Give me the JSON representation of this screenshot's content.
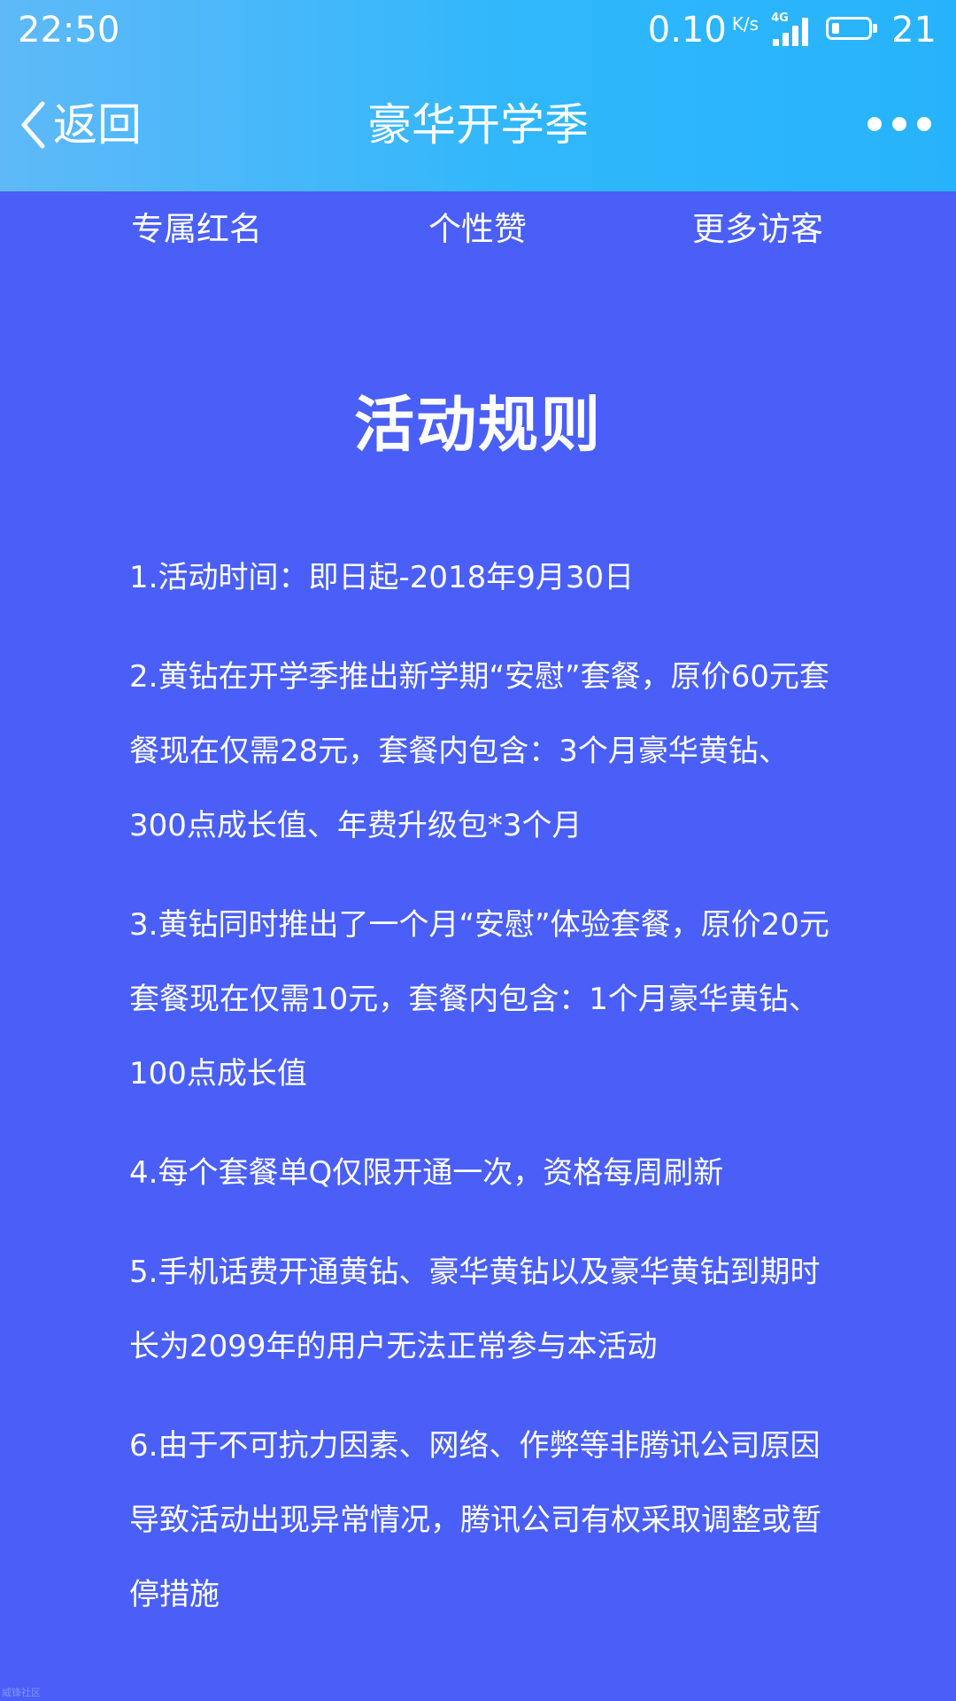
{
  "status_bar": {
    "time": "22:50",
    "net_speed": "0.10",
    "net_unit": "K/s",
    "network_type": "4G",
    "battery_level": "21",
    "battery_fill_fraction": 0.2
  },
  "nav": {
    "back_label": "返回",
    "title": "豪华开学季",
    "more_icon": "more-horizontal-icon"
  },
  "subnav": {
    "items": [
      "专属红名",
      "个性赞",
      "更多访客"
    ]
  },
  "rules": {
    "title": "活动规则",
    "items": [
      "1.活动时间：即日起-2018年9月30日",
      "2.黄钻在开学季推出新学期“安慰”套餐，原价60元套餐现在仅需28元，套餐内包含：3个月豪华黄钻、300点成长值、年费升级包*3个月",
      "3.黄钻同时推出了一个月“安慰”体验套餐，原价20元套餐现在仅需10元，套餐内包含：1个月豪华黄钻、100点成长值",
      "4.每个套餐单Q仅限开通一次，资格每周刷新",
      "5.手机话费开通黄钻、豪华黄钻以及豪华黄钻到期时长为2099年的用户无法正常参与本活动",
      "6.由于不可抗力因素、网络、作弊等非腾讯公司原因导致活动出现异常情况，腾讯公司有权采取调整或暂停措施"
    ]
  },
  "watermark": "威锋社区",
  "colors": {
    "header_gradient_start": "#5fb9f8",
    "header_gradient_end": "#27b3fb",
    "page_background": "#4a5ff7",
    "text": "#ffffff"
  }
}
